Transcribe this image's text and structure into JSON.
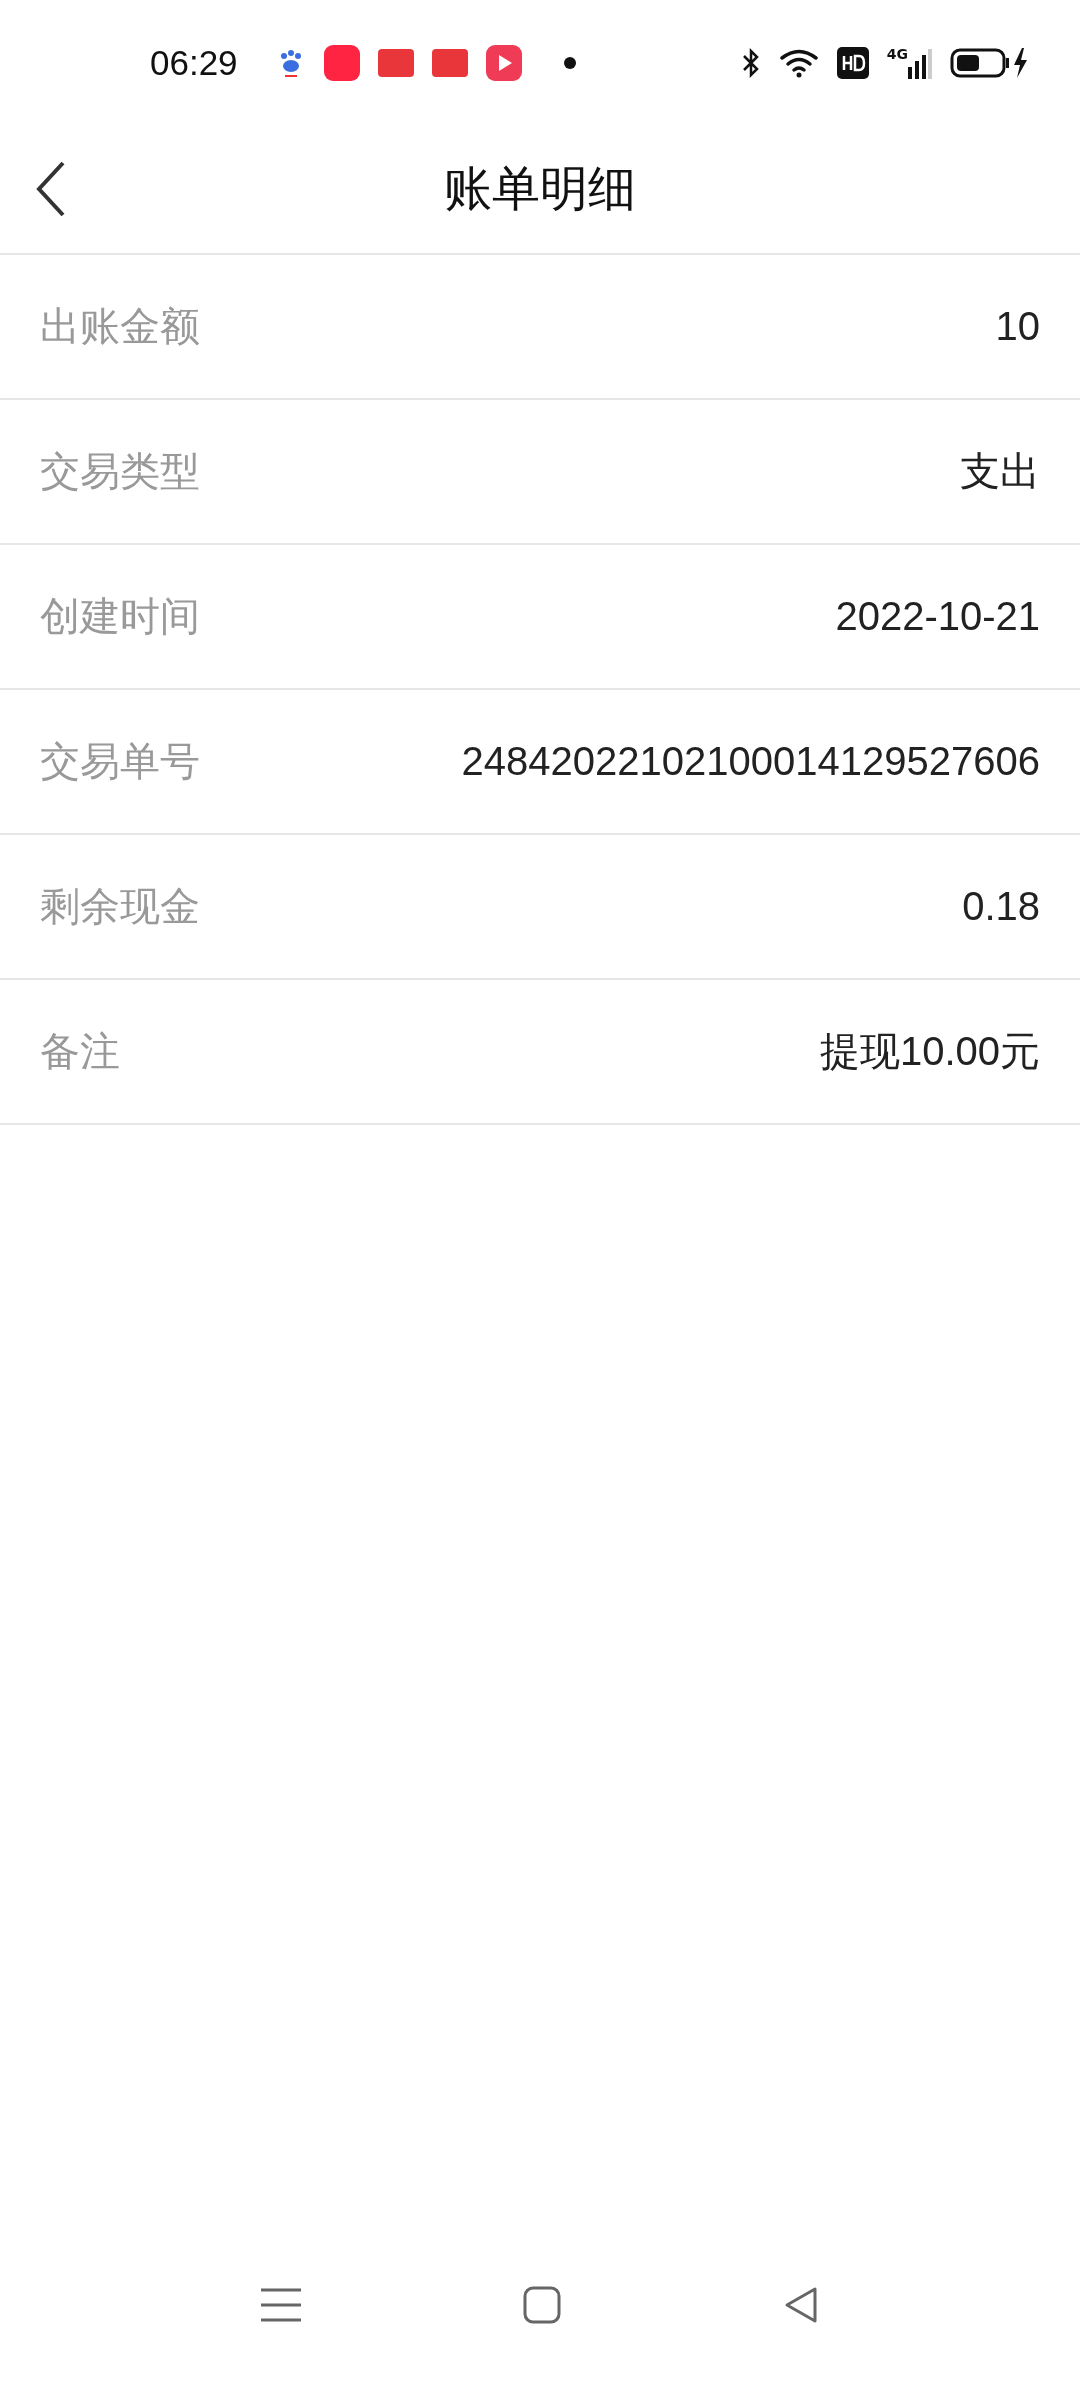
{
  "status_bar": {
    "time": "06:29",
    "network": "4G"
  },
  "header": {
    "title": "账单明细"
  },
  "rows": [
    {
      "label": "出账金额",
      "value": "10"
    },
    {
      "label": "交易类型",
      "value": "支出"
    },
    {
      "label": "创建时间",
      "value": "2022-10-21"
    },
    {
      "label": "交易单号",
      "value": "24842022102100014129527606"
    },
    {
      "label": "剩余现金",
      "value": "0.18"
    },
    {
      "label": "备注",
      "value": "提现10.00元"
    }
  ]
}
